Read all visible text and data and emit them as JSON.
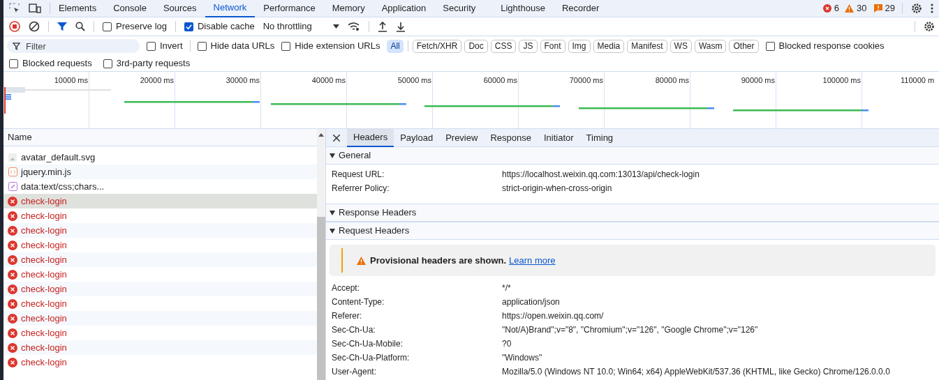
{
  "main_tabs": [
    {
      "label": "Elements",
      "selected": false
    },
    {
      "label": "Console",
      "selected": false
    },
    {
      "label": "Sources",
      "selected": false
    },
    {
      "label": "Network",
      "selected": true
    },
    {
      "label": "Performance",
      "selected": false
    },
    {
      "label": "Memory",
      "selected": false
    },
    {
      "label": "Application",
      "selected": false
    },
    {
      "label": "Security",
      "selected": false
    },
    {
      "label": "Lighthouse",
      "selected": false
    },
    {
      "label": "Recorder",
      "selected": false
    }
  ],
  "counts": {
    "errors": "6",
    "warnings": "30",
    "issues": "29"
  },
  "toolbar": {
    "preserve_log": {
      "label": "Preserve log",
      "checked": false
    },
    "disable_cache": {
      "label": "Disable cache",
      "checked": true
    },
    "throttling": "No throttling"
  },
  "filter": {
    "placeholder": "Filter",
    "invert": {
      "label": "Invert",
      "checked": false
    },
    "hide_data_urls": {
      "label": "Hide data URLs",
      "checked": false
    },
    "hide_extension_urls": {
      "label": "Hide extension URLs",
      "checked": false
    },
    "types": [
      {
        "label": "All",
        "selected": true
      },
      {
        "label": "Fetch/XHR",
        "selected": false
      },
      {
        "label": "Doc",
        "selected": false
      },
      {
        "label": "CSS",
        "selected": false
      },
      {
        "label": "JS",
        "selected": false
      },
      {
        "label": "Font",
        "selected": false
      },
      {
        "label": "Img",
        "selected": false
      },
      {
        "label": "Media",
        "selected": false
      },
      {
        "label": "Manifest",
        "selected": false
      },
      {
        "label": "WS",
        "selected": false
      },
      {
        "label": "Wasm",
        "selected": false
      },
      {
        "label": "Other",
        "selected": false
      }
    ],
    "blocked_response_cookies": {
      "label": "Blocked response cookies",
      "checked": false
    },
    "blocked_requests": {
      "label": "Blocked requests",
      "checked": false
    },
    "third_party": {
      "label": "3rd-party requests",
      "checked": false
    }
  },
  "timeline": {
    "ticks": [
      "10000 ms",
      "20000 ms",
      "30000 ms",
      "40000 ms",
      "50000 ms",
      "60000 ms",
      "70000 ms",
      "80000 ms",
      "90000 ms",
      "100000 ms",
      "110000 m"
    ]
  },
  "requests": {
    "column": "Name",
    "rows": [
      {
        "name": "avatar_default.svg",
        "kind": "image",
        "error": false,
        "selected": false
      },
      {
        "name": "jquery.min.js",
        "kind": "script",
        "error": false,
        "selected": false
      },
      {
        "name": "data:text/css;chars...",
        "kind": "style",
        "error": false,
        "selected": false
      },
      {
        "name": "check-login",
        "kind": "fetch",
        "error": true,
        "selected": true
      },
      {
        "name": "check-login",
        "kind": "fetch",
        "error": true,
        "selected": false
      },
      {
        "name": "check-login",
        "kind": "fetch",
        "error": true,
        "selected": false
      },
      {
        "name": "check-login",
        "kind": "fetch",
        "error": true,
        "selected": false
      },
      {
        "name": "check-login",
        "kind": "fetch",
        "error": true,
        "selected": false
      },
      {
        "name": "check-login",
        "kind": "fetch",
        "error": true,
        "selected": false
      },
      {
        "name": "check-login",
        "kind": "fetch",
        "error": true,
        "selected": false
      },
      {
        "name": "check-login",
        "kind": "fetch",
        "error": true,
        "selected": false
      },
      {
        "name": "check-login",
        "kind": "fetch",
        "error": true,
        "selected": false
      },
      {
        "name": "check-login",
        "kind": "fetch",
        "error": true,
        "selected": false
      },
      {
        "name": "check-login",
        "kind": "fetch",
        "error": true,
        "selected": false
      },
      {
        "name": "check-login",
        "kind": "fetch",
        "error": true,
        "selected": false
      }
    ]
  },
  "detail": {
    "tabs": [
      {
        "label": "Headers",
        "selected": true
      },
      {
        "label": "Payload",
        "selected": false
      },
      {
        "label": "Preview",
        "selected": false
      },
      {
        "label": "Response",
        "selected": false
      },
      {
        "label": "Initiator",
        "selected": false
      },
      {
        "label": "Timing",
        "selected": false
      }
    ],
    "general": {
      "title": "General",
      "expanded": true,
      "rows": [
        {
          "name": "Request URL:",
          "value": "https://localhost.weixin.qq.com:13013/api/check-login"
        },
        {
          "name": "Referrer Policy:",
          "value": "strict-origin-when-cross-origin"
        }
      ]
    },
    "response_headers": {
      "title": "Response Headers",
      "expanded": true
    },
    "request_headers": {
      "title": "Request Headers",
      "expanded": true,
      "warning": "Provisional headers are shown.",
      "link": "Learn more",
      "rows": [
        {
          "name": "Accept:",
          "value": "*/*"
        },
        {
          "name": "Content-Type:",
          "value": "application/json"
        },
        {
          "name": "Referer:",
          "value": "https://open.weixin.qq.com/"
        },
        {
          "name": "Sec-Ch-Ua:",
          "value": "\"Not/A)Brand\";v=\"8\", \"Chromium\";v=\"126\", \"Google Chrome\";v=\"126\""
        },
        {
          "name": "Sec-Ch-Ua-Mobile:",
          "value": "?0"
        },
        {
          "name": "Sec-Ch-Ua-Platform:",
          "value": "\"Windows\""
        },
        {
          "name": "User-Agent:",
          "value": "Mozilla/5.0 (Windows NT 10.0; Win64; x64) AppleWebKit/537.36 (KHTML, like Gecko) Chrome/126.0.0.0"
        }
      ]
    }
  }
}
